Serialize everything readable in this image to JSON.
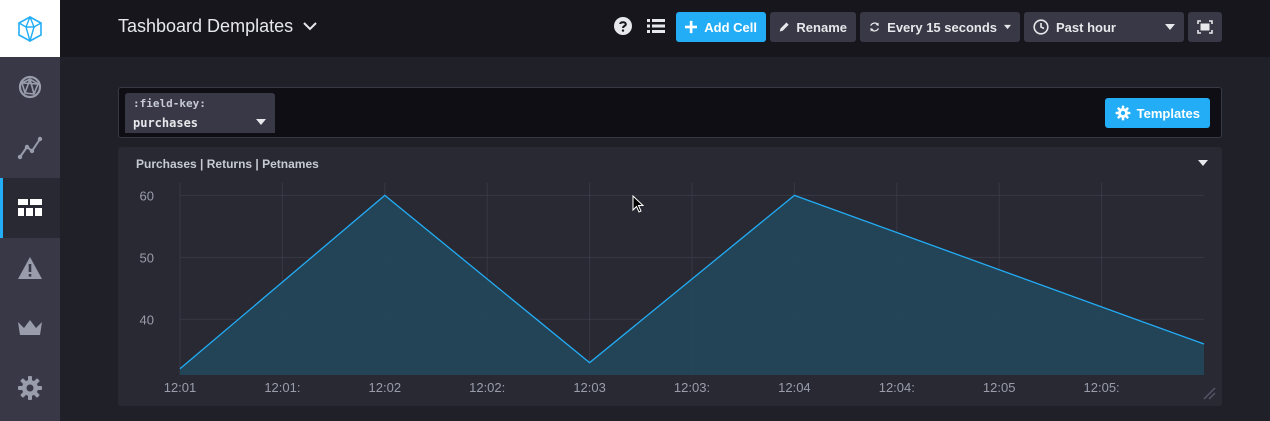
{
  "colors": {
    "accent": "#22adf6",
    "header_bg": "#16161c",
    "sidebar_bg": "#383846",
    "page_bg": "#202028",
    "cell_bg": "#292933",
    "line": "#22adf6",
    "fill": "#22465a"
  },
  "sidebar": {
    "logo": "influx-logo-icon",
    "items": [
      {
        "icon": "planet-icon",
        "active": false
      },
      {
        "icon": "graph-icon",
        "active": false
      },
      {
        "icon": "dashboards-icon",
        "active": true
      },
      {
        "icon": "alert-triangle-icon",
        "active": false
      },
      {
        "icon": "crown-icon",
        "active": false
      },
      {
        "icon": "gear-icon",
        "active": false
      }
    ]
  },
  "header": {
    "title": "Tashboard Demplates",
    "help_icon": "question-circle-icon",
    "template_vars_icon": "list-icon",
    "add_cell_label": "Add Cell",
    "rename_label": "Rename",
    "refresh_label": "Every 15 seconds",
    "time_range_label": "Past hour",
    "fullscreen_icon": "fullscreen-icon"
  },
  "template_bar": {
    "variable_key": ":field-key:",
    "variable_value": "purchases",
    "templates_button": "Templates"
  },
  "cell": {
    "title": "Purchases | Returns | Petnames"
  },
  "chart_data": {
    "type": "area",
    "x_ticks": [
      "12:01",
      "12:01:",
      "12:02",
      "12:02:",
      "12:03",
      "12:03:",
      "12:04",
      "12:04:",
      "12:05",
      "12:05:"
    ],
    "y_ticks": [
      40,
      50,
      60
    ],
    "ylim": [
      31,
      62
    ],
    "points": [
      {
        "x": 0,
        "y": 32
      },
      {
        "x": 2,
        "y": 60
      },
      {
        "x": 4,
        "y": 33
      },
      {
        "x": 6,
        "y": 60
      },
      {
        "x": 10.1,
        "y": 36
      }
    ]
  }
}
